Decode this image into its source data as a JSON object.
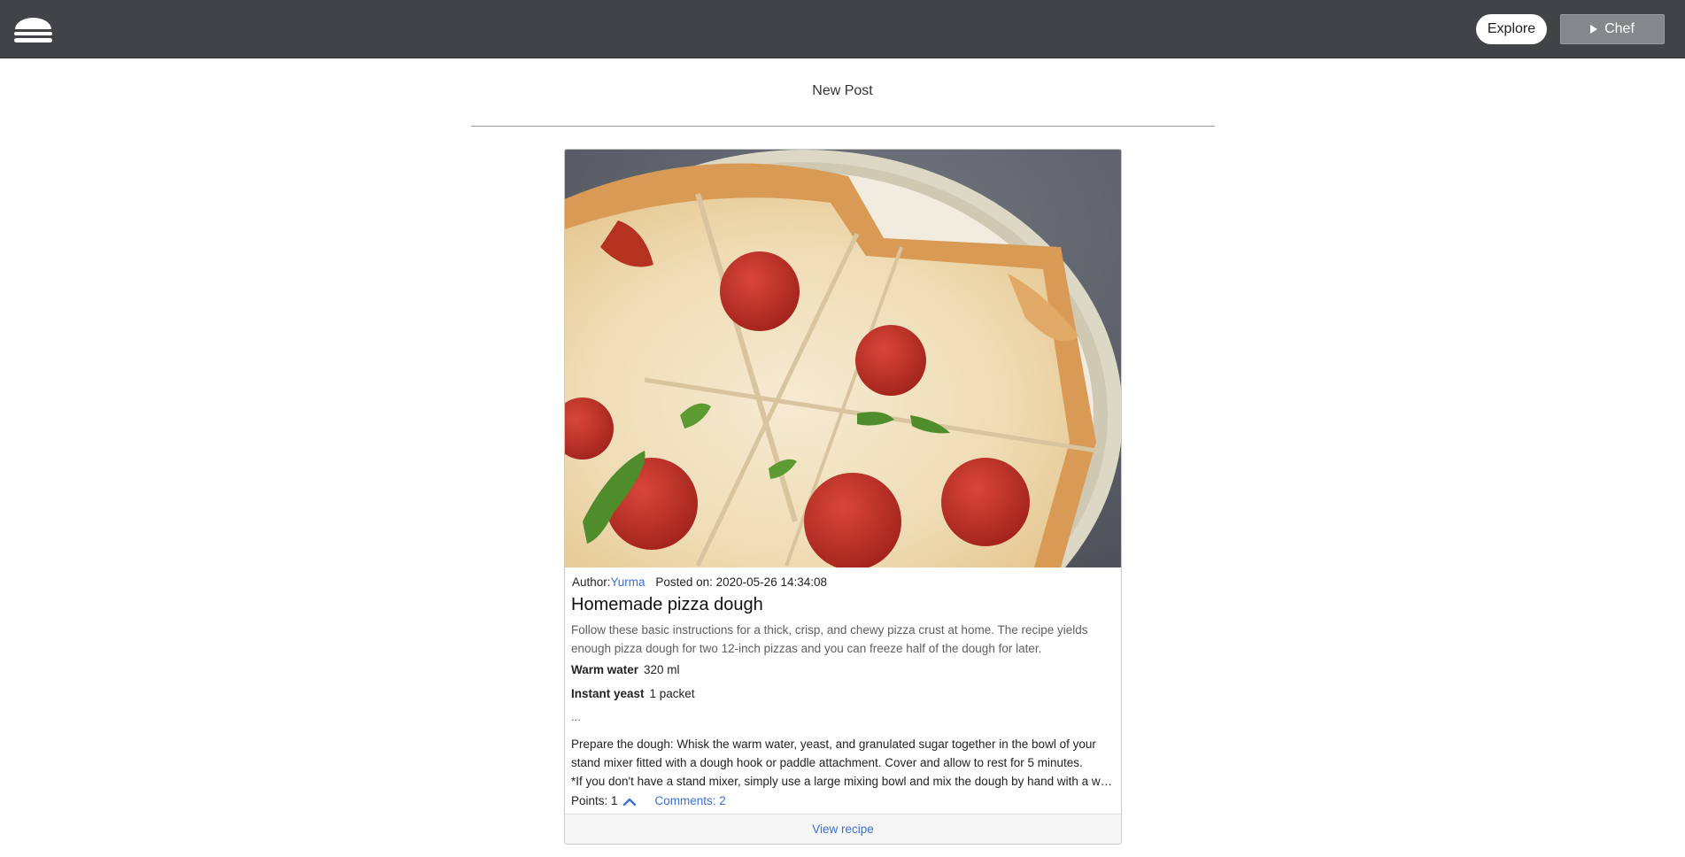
{
  "header": {
    "logo_icon": "burger-icon",
    "explore_label": "Explore",
    "chef_label": "Chef",
    "chef_icon": "play-triangle-icon"
  },
  "main": {
    "new_post_label": "New Post"
  },
  "post": {
    "image_icon": "pizza-photo",
    "author_prefix": "Author:",
    "author_name": "Yurma",
    "posted_prefix": "Posted on: ",
    "posted_date": "2020-05-26 14:34:08",
    "title": "Homemade pizza dough",
    "description": "Follow these basic instructions for a thick, crisp, and chewy pizza crust at home. The recipe yields enough pizza dough for two 12-inch pizzas and you can freeze half of the dough for later.",
    "ingredients": [
      {
        "name": "Warm water",
        "amount": "320 ml"
      },
      {
        "name": "Instant yeast",
        "amount": "1 packet"
      }
    ],
    "ellipsis": "...",
    "steps_line1": "Prepare the dough: Whisk the warm water, yeast, and granulated sugar together in the bowl of your stand mixer fitted with a dough hook or paddle attachment. Cover and allow to rest for 5 minutes.",
    "steps_line2": "*If you don't have a stand mixer, simply use a large mixing bowl and mix the dough by hand with a wooden spoon or silicone spatula instead.",
    "points_label": "Points: 1",
    "upvote_icon": "chevron-up-icon",
    "comments_label": "Comments: 2",
    "view_recipe_label": "View recipe"
  },
  "colors": {
    "topbar": "#424346",
    "link": "#3b6fd3",
    "chef_button": "#85878a"
  }
}
